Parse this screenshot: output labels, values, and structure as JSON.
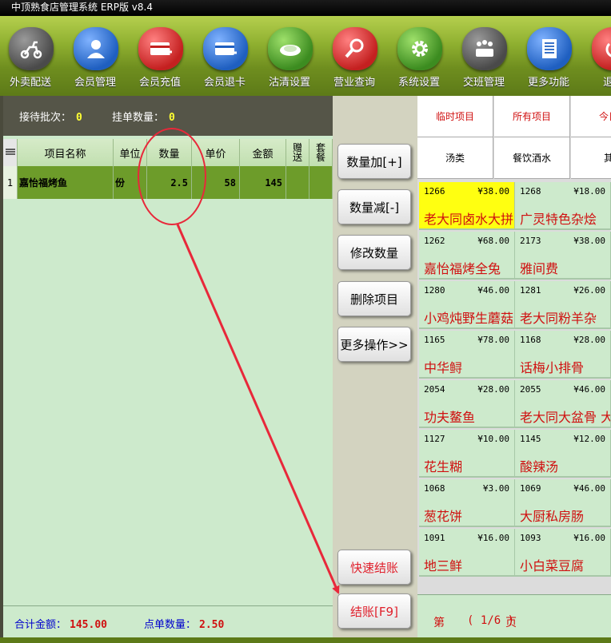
{
  "window": {
    "title": "中顶熟食店管理系统 ERP版 v8.4"
  },
  "toolbar": {
    "items": [
      {
        "label": "外卖配送",
        "icon": "scooter-icon",
        "color": "#4a4a4a"
      },
      {
        "label": "会员管理",
        "icon": "member-user-icon",
        "color": "#1f5fc0"
      },
      {
        "label": "会员充值",
        "icon": "card-plus-icon",
        "color": "#c42020"
      },
      {
        "label": "会员退卡",
        "icon": "card-minus-icon",
        "color": "#1f5fc0"
      },
      {
        "label": "沽清设置",
        "icon": "plate-icon",
        "color": "#3c8c20"
      },
      {
        "label": "营业查询",
        "icon": "magnifier-icon",
        "color": "#c42020"
      },
      {
        "label": "系统设置",
        "icon": "gear-icon",
        "color": "#3c8c20"
      },
      {
        "label": "交班管理",
        "icon": "meeting-icon",
        "color": "#4a4a4a"
      },
      {
        "label": "更多功能",
        "icon": "list-icon",
        "color": "#1f5fc0"
      },
      {
        "label": "退出",
        "icon": "power-icon",
        "color": "#c42020"
      }
    ]
  },
  "status": {
    "waiting_label": "接待批次：",
    "waiting_value": "0",
    "hold_label": "挂单数量：",
    "hold_value": "0"
  },
  "order_table": {
    "columns": [
      "项目名称",
      "单位",
      "数量",
      "单价",
      "金额",
      "赠送",
      "套餐"
    ],
    "rows": [
      {
        "index": "1",
        "name": "嘉怡福烤鱼",
        "unit": "份",
        "qty": "2.5",
        "price": "58",
        "amount": "145",
        "gift": "",
        "set": ""
      }
    ]
  },
  "totals": {
    "amount_label": "合计金额：",
    "amount_value": "145.00",
    "count_label": "点单数量：",
    "count_value": "2.50"
  },
  "actions": {
    "qty_plus": "数量加[+]",
    "qty_minus": "数量减[-]",
    "edit_qty": "修改数量",
    "delete_item": "删除项目",
    "more_ops": "更多操作>>",
    "quick_checkout": "快速结账",
    "checkout": "结账[F9]"
  },
  "category_tabs": {
    "row1": [
      "临时项目",
      "所有项目",
      "今日"
    ],
    "row2": [
      "汤类",
      "餐饮酒水",
      "其"
    ]
  },
  "menu_items": [
    {
      "code": "1266",
      "price": "¥38.00",
      "name": "老大同卤水大拼",
      "selected": true
    },
    {
      "code": "1268",
      "price": "¥18.00",
      "name": "广灵特色杂烩",
      "selected": false
    },
    {
      "code": "1262",
      "price": "¥68.00",
      "name": "嘉怡福烤全兔",
      "selected": false
    },
    {
      "code": "2173",
      "price": "¥38.00",
      "name": "雅间费",
      "selected": false
    },
    {
      "code": "1280",
      "price": "¥46.00",
      "name": "小鸡炖野生蘑菇",
      "selected": false
    },
    {
      "code": "1281",
      "price": "¥26.00",
      "name": "老大同粉羊杂",
      "selected": false
    },
    {
      "code": "1165",
      "price": "¥78.00",
      "name": "中华鲟",
      "selected": false
    },
    {
      "code": "1168",
      "price": "¥28.00",
      "name": "话梅小排骨",
      "selected": false
    },
    {
      "code": "2054",
      "price": "¥28.00",
      "name": "功夫鳌鱼",
      "selected": false
    },
    {
      "code": "2055",
      "price": "¥46.00",
      "name": "老大同大盆骨 大",
      "selected": false
    },
    {
      "code": "1127",
      "price": "¥10.00",
      "name": "花生糊",
      "selected": false
    },
    {
      "code": "1145",
      "price": "¥12.00",
      "name": "酸辣汤",
      "selected": false
    },
    {
      "code": "1068",
      "price": "¥3.00",
      "name": "葱花饼",
      "selected": false
    },
    {
      "code": "1069",
      "price": "¥46.00",
      "name": "大厨私房肠",
      "selected": false
    },
    {
      "code": "1091",
      "price": "¥16.00",
      "name": "地三鲜",
      "selected": false
    },
    {
      "code": "1093",
      "price": "¥16.00",
      "name": "小白菜豆腐",
      "selected": false
    }
  ],
  "pager": {
    "prefix": "第",
    "current": "( 1/6 )",
    "suffix": "页"
  },
  "colors": {
    "annotation_red": "#e8283a",
    "selected_item": "#ffff11",
    "order_row": "#6d9c2a",
    "panel_green": "#cdeacc"
  }
}
